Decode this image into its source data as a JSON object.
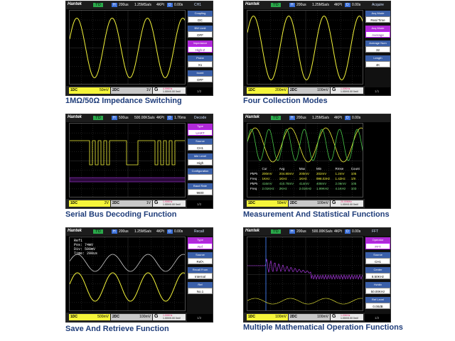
{
  "panels": [
    {
      "caption": "1MΩ/50Ω Impedance Switching",
      "topbar": {
        "brand": "Hantek",
        "t": "T'D",
        "h": "H",
        "time": "200us",
        "rate": "1.25MSa/s",
        "pts": "4KPt",
        "d": "D",
        "offset": "0.00s",
        "menu": "CH1"
      },
      "menu": [
        {
          "title": "Coupling",
          "value": "DC",
          "hl": false
        },
        {
          "title": "BW Limit",
          "value": "OFF",
          "hl": false
        },
        {
          "title": "Impedance",
          "value": "High-Z",
          "hl": true
        },
        {
          "title": "Probe",
          "value": "X1",
          "hl": false
        },
        {
          "title": "Invert",
          "value": "OFF",
          "hl": false
        }
      ],
      "page": "1/2",
      "ch1": {
        "name": "1DC",
        "scale": "50mV"
      },
      "ch2": {
        "name": "2DC",
        "scale": "1V"
      },
      "trig": {
        "freq": "4.99KHz",
        "level": "1.00V/0.00 0mV"
      }
    },
    {
      "caption": "Four Collection Modes",
      "topbar": {
        "brand": "Hantek",
        "t": "T'D",
        "h": "H",
        "time": "200us",
        "rate": "1.25MSa/s",
        "pts": "4KPt",
        "d": "D",
        "offset": "0.00s",
        "menu": "Acquire"
      },
      "menu": [
        {
          "title": "Acq Mode",
          "value": "Real Time",
          "hl": false
        },
        {
          "title": "Acq Mode",
          "value": "Average",
          "hl": true
        },
        {
          "title": "Average Num",
          "value": "32",
          "hl": false
        },
        {
          "title": "Length",
          "value": "4K",
          "hl": false
        }
      ],
      "page": "1/1",
      "ch1": {
        "name": "1DC",
        "scale": "200mV"
      },
      "ch2": {
        "name": "2DC",
        "scale": "100mV"
      },
      "trig": {
        "freq": "1.00KHz",
        "level": "1.00V/0.00 0mV"
      }
    },
    {
      "caption": "Serial Bus Decoding Function",
      "topbar": {
        "brand": "Hantek",
        "t": "T'D",
        "h": "H",
        "time": "500us",
        "rate": "500.00KSa/s",
        "pts": "4KPt",
        "d": "D",
        "offset": "1.76ms",
        "menu": "Decode"
      },
      "menu": [
        {
          "title": "Type",
          "value": "UART",
          "hl": true
        },
        {
          "title": "Source",
          "value": "CH1",
          "hl": false
        },
        {
          "title": "Idle Level",
          "value": "High",
          "hl": false
        },
        {
          "title": "Configuration",
          "value": "",
          "hl": false
        },
        {
          "title": "Baud Rate",
          "value": "9600",
          "hl": false
        }
      ],
      "page": "1/2",
      "ch1": {
        "name": "1DC",
        "scale": "2V"
      },
      "ch2": {
        "name": "2DC",
        "scale": "1V"
      },
      "trig": {
        "freq": "1.90KHz",
        "level": "1.00V/0.00 0mV"
      }
    },
    {
      "caption": "Measurement And Statistical Functions",
      "topbar": {
        "brand": "Hantek",
        "t": "T'D",
        "h": "H",
        "time": "200us",
        "rate": "1.25MSa/s",
        "pts": "4KPt",
        "d": "D",
        "offset": "0.00s",
        "menu": ""
      },
      "menu": [],
      "page": "",
      "ch1": {
        "name": "1DC",
        "scale": "50mV"
      },
      "ch2": {
        "name": "2DC",
        "scale": "100mV"
      },
      "trig": {
        "freq": "20.00MHz",
        "level": "1.00V/0.00 0mV"
      },
      "meas": {
        "headers": [
          "",
          "Cur",
          "Avg",
          "Max",
          "Min",
          "Rmse",
          "Count"
        ],
        "rows": [
          [
            "PkPk",
            "200mV",
            "204.80mV",
            "200mV",
            "202mV",
            "1.2mV",
            "105"
          ],
          [
            "Freq",
            "1KHz",
            "1KHz",
            "1KHz",
            "998.03Hz",
            "1.42Hz",
            "1/8"
          ],
          [
            "PkPk",
            "416mV",
            "410.78mV",
            "414mV",
            "408mV",
            "2.06mV",
            "105"
          ],
          [
            "Freq",
            "2.01KHz",
            "2KHz",
            "2.01KHz",
            "1.99KHz",
            "4.1KHz",
            "103"
          ]
        ]
      }
    },
    {
      "caption": "Save And Retrieve Function",
      "topbar": {
        "brand": "Hantek",
        "t": "T'D",
        "h": "H",
        "time": "200us",
        "rate": "1.25MSa/s",
        "pts": "4KPt",
        "d": "D",
        "offset": "0.00s",
        "menu": "Recall"
      },
      "menu": [
        {
          "title": "Type",
          "value": "Ref",
          "hl": true
        },
        {
          "title": "Source",
          "value": "RefA",
          "hl": false
        },
        {
          "title": "Recall From",
          "value": "Internal",
          "hl": false
        },
        {
          "title": "Ref",
          "value": "No.1",
          "hl": false
        }
      ],
      "page": "1/2",
      "refinfo": [
        "Ref1",
        "Pos: 74mV",
        "Div: 500mV",
        "Time: 200us"
      ],
      "ch1": {
        "name": "1DC",
        "scale": "500mV"
      },
      "ch2": {
        "name": "2DC",
        "scale": "100mV"
      },
      "trig": {
        "freq": "1.00KHz",
        "level": "1.00V/0.00 0mV"
      }
    },
    {
      "caption": "Multiple Mathematical Operation Functions",
      "topbar": {
        "brand": "Hantek",
        "t": "T'D",
        "h": "H",
        "time": "200us",
        "rate": "500.00KSa/s",
        "pts": "4KPt",
        "d": "D",
        "offset": "0.00s",
        "menu": "FFT"
      },
      "menu": [
        {
          "title": "Operator",
          "value": "FFT",
          "hl": true
        },
        {
          "title": "Source",
          "value": "CH1",
          "hl": false
        },
        {
          "title": "Center",
          "value": "8.50KHz",
          "hl": false
        },
        {
          "title": "Hz/div",
          "value": "50.00KHz",
          "hl": false
        },
        {
          "title": "Ref Level",
          "value": "0.00dB",
          "hl": false
        }
      ],
      "page": "1/2",
      "ch1": {
        "name": "1DC",
        "scale": "100mV"
      },
      "ch2": {
        "name": "2DC",
        "scale": "100mV"
      },
      "trig": {
        "freq": "1.00KHz",
        "level": "1.00V/0.00 0mV"
      }
    }
  ],
  "colors": {
    "ch1": "#f5f53a",
    "ch2": "#c8c8c8",
    "math": "#c040ff",
    "menu_title": "#3a5fa8",
    "caption": "#1f3d7a"
  }
}
